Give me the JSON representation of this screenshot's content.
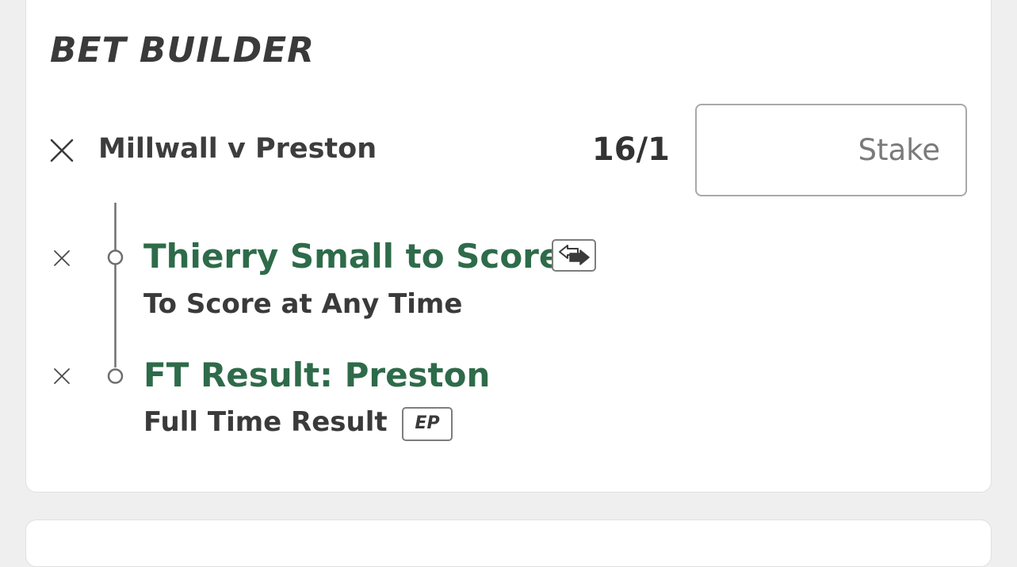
{
  "bet_builder": {
    "title": "BET BUILDER",
    "match": "Millwall v Preston",
    "odds": "16/1",
    "stake_placeholder": "Stake",
    "selections": [
      {
        "name": "Thierry Small to Score",
        "market": "To Score at Any Time",
        "badge_icon": "swap-arrows-icon"
      },
      {
        "name": "FT Result: Preston",
        "market": "Full Time Result",
        "badge": "EP"
      }
    ]
  },
  "colors": {
    "selection_name": "#2e6b4a",
    "text": "#3a3a3a",
    "background": "#efefef",
    "card": "#ffffff"
  }
}
